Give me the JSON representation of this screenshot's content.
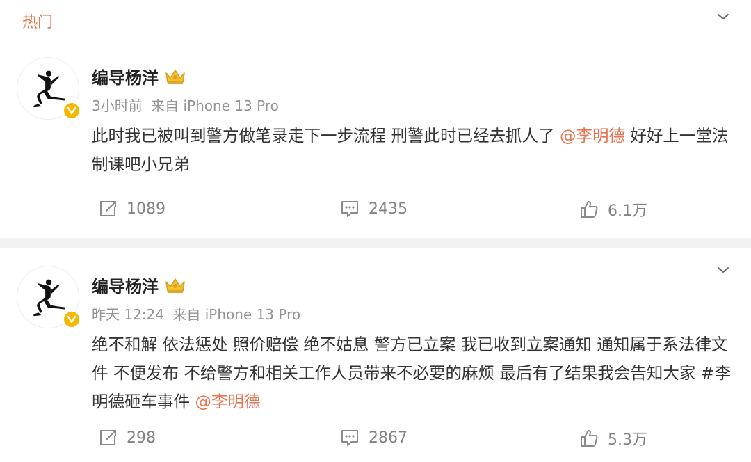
{
  "section": {
    "title": "热门"
  },
  "posts": [
    {
      "author": "编导杨洋",
      "time": "3小时前",
      "source": "来自 iPhone 13 Pro",
      "content": {
        "text": "此时我已被叫到警方做笔录走下一步流程 刑警此时已经去抓人了 ",
        "mention": "@李明德",
        "text_after": " 好好上一堂法制课吧小兄弟"
      },
      "stats": {
        "reposts": "1089",
        "comments": "2435",
        "likes": "6.1万"
      }
    },
    {
      "author": "编导杨洋",
      "time": "昨天 12:24",
      "source": "来自 iPhone 13 Pro",
      "content": {
        "text": "绝不和解 依法惩处 照价赔偿 绝不姑息 警方已立案 我已收到立案通知 通知属于系法律文件 不便发布 不给警方和相关工作人员带来不必要的麻烦 最后有了结果我会告知大家 #李明德砸车事件 ",
        "mention": "@李明德",
        "text_after": ""
      },
      "stats": {
        "reposts": "298",
        "comments": "2867",
        "likes": "5.3万"
      }
    }
  ],
  "icons": {
    "avatar": "jumpman-logo",
    "badge": "verified-v-icon",
    "crown": "crown-icon",
    "more": "chevron-down-icon",
    "repost": "repost-icon",
    "comment": "comment-icon",
    "like": "like-icon"
  },
  "colors": {
    "section_title": "#e37a4a",
    "mention": "#eb7350",
    "meta": "#939393",
    "divider": "#f2f2f2",
    "verified_badge": "#f5b700"
  }
}
